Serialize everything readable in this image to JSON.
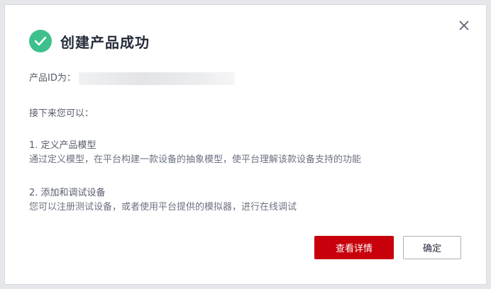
{
  "dialog": {
    "title": "创建产品成功",
    "close_icon": "close-icon",
    "success_icon": "check-circle-icon",
    "product_id_label": "产品ID为：",
    "next_label": "接下来您可以：",
    "steps": [
      {
        "title": "1. 定义产品模型",
        "desc": "通过定义模型，在平台构建一款设备的抽象模型，使平台理解该款设备支持的功能"
      },
      {
        "title": "2. 添加和调试设备",
        "desc": "您可以注册测试设备，或者使用平台提供的模拟器，进行在线调试"
      }
    ],
    "primary_button": "查看详情",
    "secondary_button": "确定"
  },
  "colors": {
    "success": "#3ec08c",
    "primary": "#c7000b"
  }
}
